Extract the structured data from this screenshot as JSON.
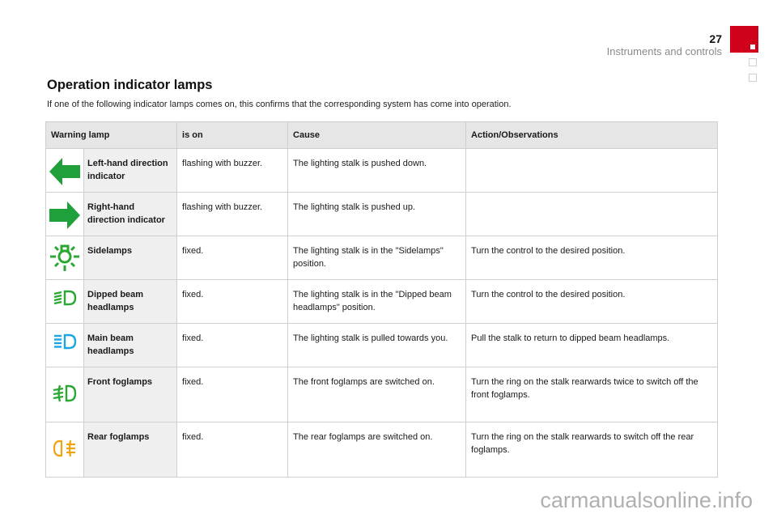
{
  "header": {
    "page_number": "27",
    "section": "Instruments and controls"
  },
  "title": "Operation indicator lamps",
  "intro": "If one of the following indicator lamps comes on, this confirms that the corresponding system has come into operation.",
  "table": {
    "headers": [
      "Warning lamp",
      "is on",
      "Cause",
      "Action/Observations"
    ],
    "rows": [
      {
        "icon": "left-arrow-icon",
        "icon_color": "#1fa03a",
        "name": "Left-hand direction indicator",
        "is_on": "flashing with buzzer.",
        "cause": "The lighting stalk is pushed down.",
        "action": ""
      },
      {
        "icon": "right-arrow-icon",
        "icon_color": "#1fa03a",
        "name": "Right-hand direction indicator",
        "is_on": "flashing with buzzer.",
        "cause": "The lighting stalk is pushed up.",
        "action": ""
      },
      {
        "icon": "sidelamps-icon",
        "icon_color": "#2aa833",
        "name": "Sidelamps",
        "is_on": "fixed.",
        "cause": "The lighting stalk is in the \"Sidelamps\" position.",
        "action": "Turn the control to the desired position."
      },
      {
        "icon": "dipped-beam-icon",
        "icon_color": "#2aa833",
        "name": "Dipped beam headlamps",
        "is_on": "fixed.",
        "cause": "The lighting stalk is in the \"Dipped beam headlamps\" position.",
        "action": "Turn the control to the desired position."
      },
      {
        "icon": "main-beam-icon",
        "icon_color": "#1aa6e0",
        "name": "Main beam headlamps",
        "is_on": "fixed.",
        "cause": "The lighting stalk is pulled towards you.",
        "action": "Pull the stalk to return to dipped beam headlamps."
      },
      {
        "icon": "front-foglamps-icon",
        "icon_color": "#2aa833",
        "name": "Front foglamps",
        "is_on": "fixed.",
        "cause": "The front foglamps are switched on.",
        "action": "Turn the ring on the stalk rearwards twice to switch off the front foglamps."
      },
      {
        "icon": "rear-foglamps-icon",
        "icon_color": "#f2a20c",
        "name": "Rear foglamps",
        "is_on": "fixed.",
        "cause": "The rear foglamps are switched on.",
        "action": "Turn the ring on the stalk rearwards to switch off the rear foglamps."
      }
    ]
  },
  "watermark": "carmanualsonline.info",
  "colors": {
    "brand_red": "#d0021b",
    "header_bg": "#e6e6e6",
    "name_bg": "#efefef",
    "border": "#cfcfcf"
  }
}
